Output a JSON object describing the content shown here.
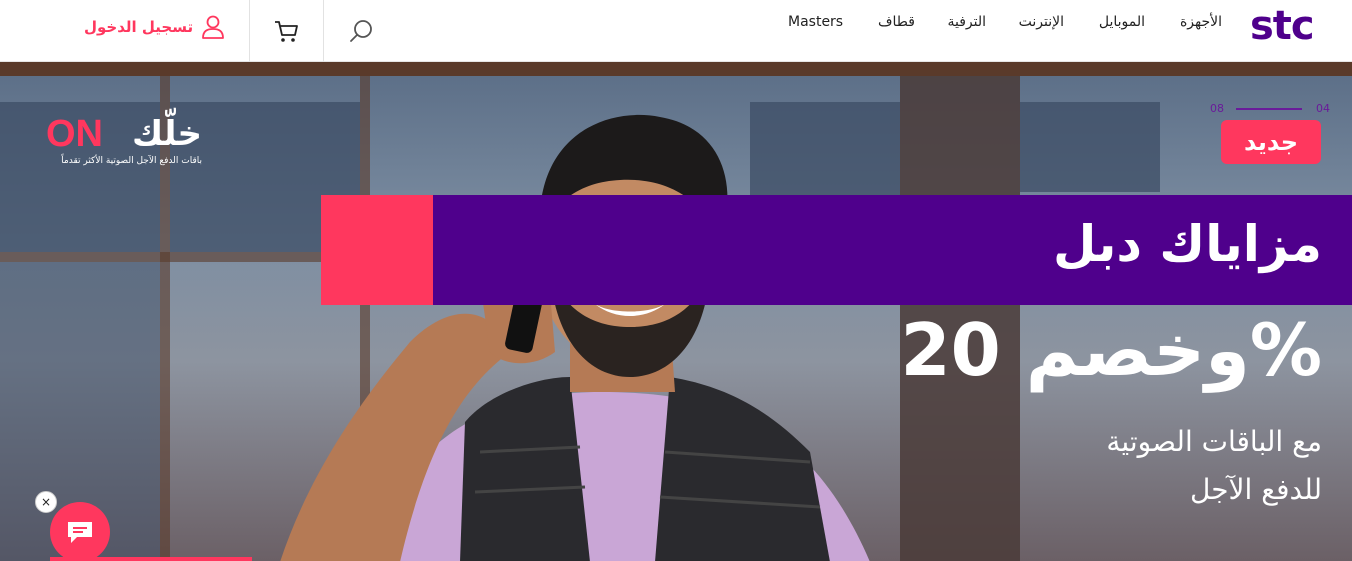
{
  "header": {
    "logo": "stc",
    "nav": [
      {
        "label": "الأجهزة"
      },
      {
        "label": "الموبايل"
      },
      {
        "label": "الإنترنت"
      },
      {
        "label": "الترفية"
      },
      {
        "label": "قطاف"
      },
      {
        "label": "Masters"
      }
    ],
    "login_label": "تسجيل الدخول"
  },
  "hero": {
    "brand": {
      "word": "خلّك",
      "on": "ON",
      "tagline": "باقات الدفع الآجل الصوتية الأكثر تقدماً"
    },
    "pager": {
      "current": "04",
      "total": "08"
    },
    "badge": "جديد",
    "headline_1": "مزاياك دبل",
    "headline_2": "وخصم 20%",
    "sub_1": "مع الباقات الصوتية",
    "sub_2": "للدفع الآجل"
  },
  "chat": {
    "close": "×"
  },
  "colors": {
    "brand_purple": "#4f008c",
    "accent_pink": "#ff375e"
  }
}
